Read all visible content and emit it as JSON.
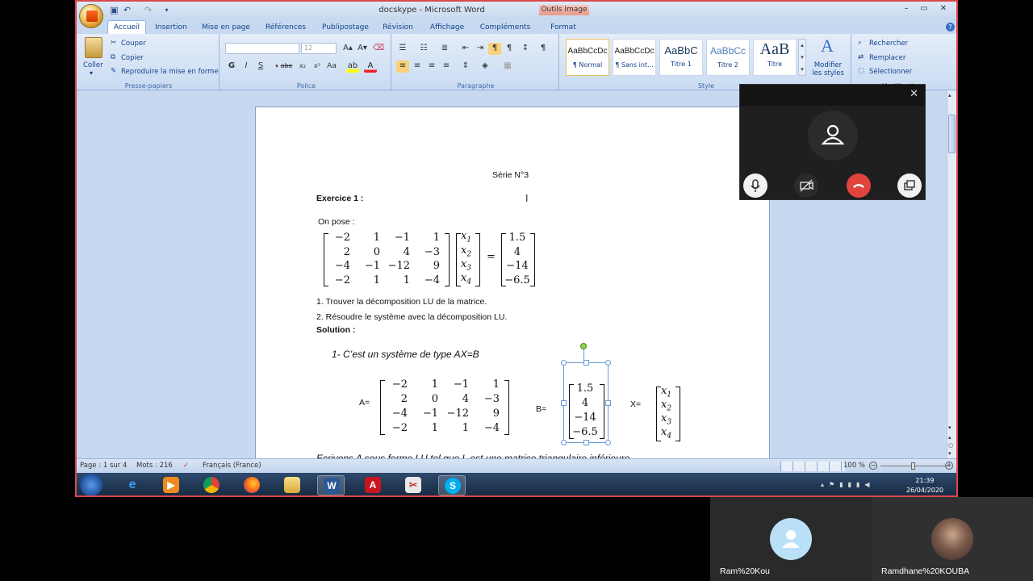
{
  "window": {
    "title": "docskype - Microsoft Word",
    "context_tab": "Outils Image"
  },
  "tabs": [
    "Accueil",
    "Insertion",
    "Mise en page",
    "Références",
    "Publipostage",
    "Révision",
    "Affichage",
    "Compléments",
    "Format"
  ],
  "ribbon": {
    "clipboard": {
      "paste": "Coller",
      "cut": "Couper",
      "copy": "Copier",
      "format_painter": "Reproduire la mise en forme",
      "label": "Presse-papiers"
    },
    "font": {
      "size": "12",
      "label": "Police",
      "bold": "G",
      "italic": "I",
      "underline": "S",
      "strike": "abe",
      "sub": "x₂",
      "sup": "x²",
      "case": "Aa"
    },
    "paragraph": {
      "label": "Paragraphe"
    },
    "styles": {
      "items": [
        {
          "sample": "AaBbCcDc",
          "name": "¶ Normal"
        },
        {
          "sample": "AaBbCcDc",
          "name": "¶ Sans int..."
        },
        {
          "sample": "AaBbC",
          "name": "Titre 1"
        },
        {
          "sample": "AaBbCc",
          "name": "Titre 2"
        },
        {
          "sample": "AaB",
          "name": "Titre"
        }
      ],
      "modify": "Modifier les styles",
      "label": "Style"
    },
    "editing": {
      "find": "Rechercher",
      "replace": "Remplacer",
      "select": "Sélectionner",
      "label": "Modification"
    }
  },
  "document": {
    "heading": "Série N°3",
    "exercise": "Exercice 1 :",
    "intro": "On pose :",
    "matrix": [
      [
        "−2",
        "1",
        "−1",
        "1"
      ],
      [
        "2",
        "0",
        "4",
        "−3"
      ],
      [
        "−4",
        "−1",
        "−12",
        "9"
      ],
      [
        "−2",
        "1",
        "1",
        "−4"
      ]
    ],
    "x_vector": [
      "x1",
      "x2",
      "x3",
      "x4"
    ],
    "rhs": [
      "1.5",
      "4",
      "−14",
      "−6.5"
    ],
    "q1": "1. Trouver la décomposition  LU de la matrice.",
    "q2": "2. Résoudre le système  avec la décomposition  LU.",
    "solution": "Solution :",
    "step1": "1-  C’est un système de type  AX=B",
    "a_label": "A=",
    "b_label": "B=",
    "x_label": "X=",
    "cutoff_line": "Ecrivons A sous forme LU   tel que L est une matrice triangulaire inférieure"
  },
  "statusbar": {
    "page": "Page : 1 sur 4",
    "words": "Mots : 216",
    "language": "Français (France)",
    "zoom": "100 %"
  },
  "taskbar": {
    "time": "21:39",
    "date": "26/04/2020"
  },
  "participants": [
    {
      "name": "Ram%20Kou"
    },
    {
      "name": "Ramdhane%20KOUBA"
    }
  ],
  "colors": {
    "accent": "#15428b",
    "hangup": "#e0443c",
    "frame": "#d8484a"
  }
}
